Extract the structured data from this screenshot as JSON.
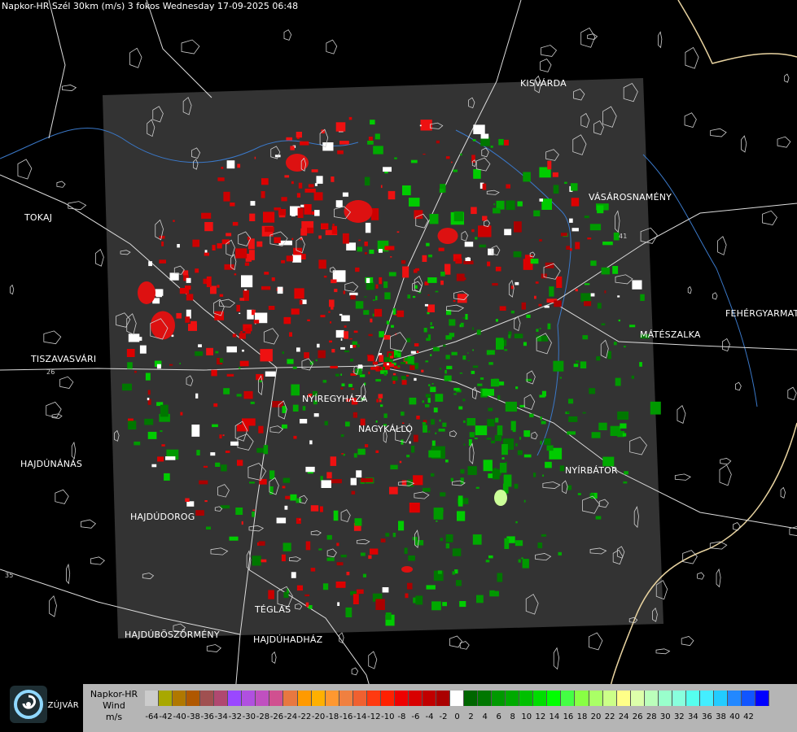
{
  "title": "Napkor-HR Szél 30km (m/s) 3 fokos Wednesday 17-09-2025 06:48",
  "places": [
    {
      "name": "KISVÁRDA"
    },
    {
      "name": "TOKAJ"
    },
    {
      "name": "VÁSÁROSNAMÉNY"
    },
    {
      "name": "FEHÉRGYARMAT"
    },
    {
      "name": "MÁTÉSZALKA"
    },
    {
      "name": "TISZAVASVÁRI"
    },
    {
      "name": "NYÍREGYHÁZA"
    },
    {
      "name": "NAGYKÁLLÓ"
    },
    {
      "name": "NYÍRBÁTOR"
    },
    {
      "name": "HAJDÚNÁNÁS"
    },
    {
      "name": "HAJDÚDOROG"
    },
    {
      "name": "TÉGLÁS"
    },
    {
      "name": "HAJDÚBÖSZÖRMÉNY"
    },
    {
      "name": "HAJDÚHADHÁZ"
    },
    {
      "name": "LMAZÚJVÁR"
    }
  ],
  "roads": [
    "26",
    "41",
    "35"
  ],
  "legend": {
    "source": "Napkor-HR",
    "quantity": "Wind",
    "unit": "m/s",
    "colors": [
      "#cccccc",
      "#a8a800",
      "#b07800",
      "#b05800",
      "#a05050",
      "#b04870",
      "#9a48ff",
      "#b050e0",
      "#c050c0",
      "#d05090",
      "#e87840",
      "#ff9a00",
      "#ffb000",
      "#ff9830",
      "#f08040",
      "#f06030",
      "#ff3a10",
      "#ff2000",
      "#ee0000",
      "#d80000",
      "#c00000",
      "#aa0000",
      "#ffffff",
      "#006600",
      "#007700",
      "#009900",
      "#00aa00",
      "#00c000",
      "#00dd00",
      "#00ff00",
      "#44ff44",
      "#88ff44",
      "#aaff66",
      "#ccff88",
      "#ffff88",
      "#ddffaa",
      "#bbffbb",
      "#99ffcc",
      "#88ffdd",
      "#55ffee",
      "#44eeff",
      "#22ccff",
      "#2288ff",
      "#1155ff",
      "#0000ff"
    ],
    "ticks": [
      "-64",
      "-42",
      "-40",
      "-38",
      "-36",
      "-34",
      "-32",
      "-30",
      "-28",
      "-26",
      "-24",
      "-22",
      "-20",
      "-18",
      "-16",
      "-14",
      "-12",
      "-10",
      "-8",
      "-6",
      "-4",
      "-2",
      "0",
      "2",
      "4",
      "6",
      "8",
      "10",
      "12",
      "14",
      "16",
      "18",
      "20",
      "22",
      "24",
      "26",
      "28",
      "30",
      "32",
      "34",
      "36",
      "38",
      "40",
      "42"
    ]
  }
}
